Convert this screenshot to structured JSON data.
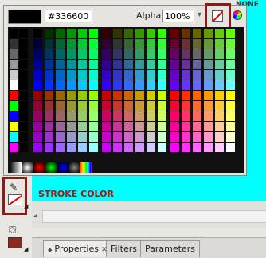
{
  "header": {
    "none_label": "NONE"
  },
  "color_panel": {
    "hex_value": "#336600",
    "alpha_label": "Alpha:",
    "alpha_value": "100%",
    "current_color": "#000000"
  },
  "tools": {
    "stroke_label": "STROKE COLOR",
    "fill_color": "#8b2a1f"
  },
  "tabs": [
    {
      "label": "Properties",
      "close": "✕",
      "active": true
    },
    {
      "label": "Filters",
      "active": false
    },
    {
      "label": "Parameters",
      "active": false
    }
  ],
  "colors": {
    "highlight_border": "#8b1a1a",
    "stroke_label": "#a11111",
    "background_cyan": "#00ffff"
  }
}
